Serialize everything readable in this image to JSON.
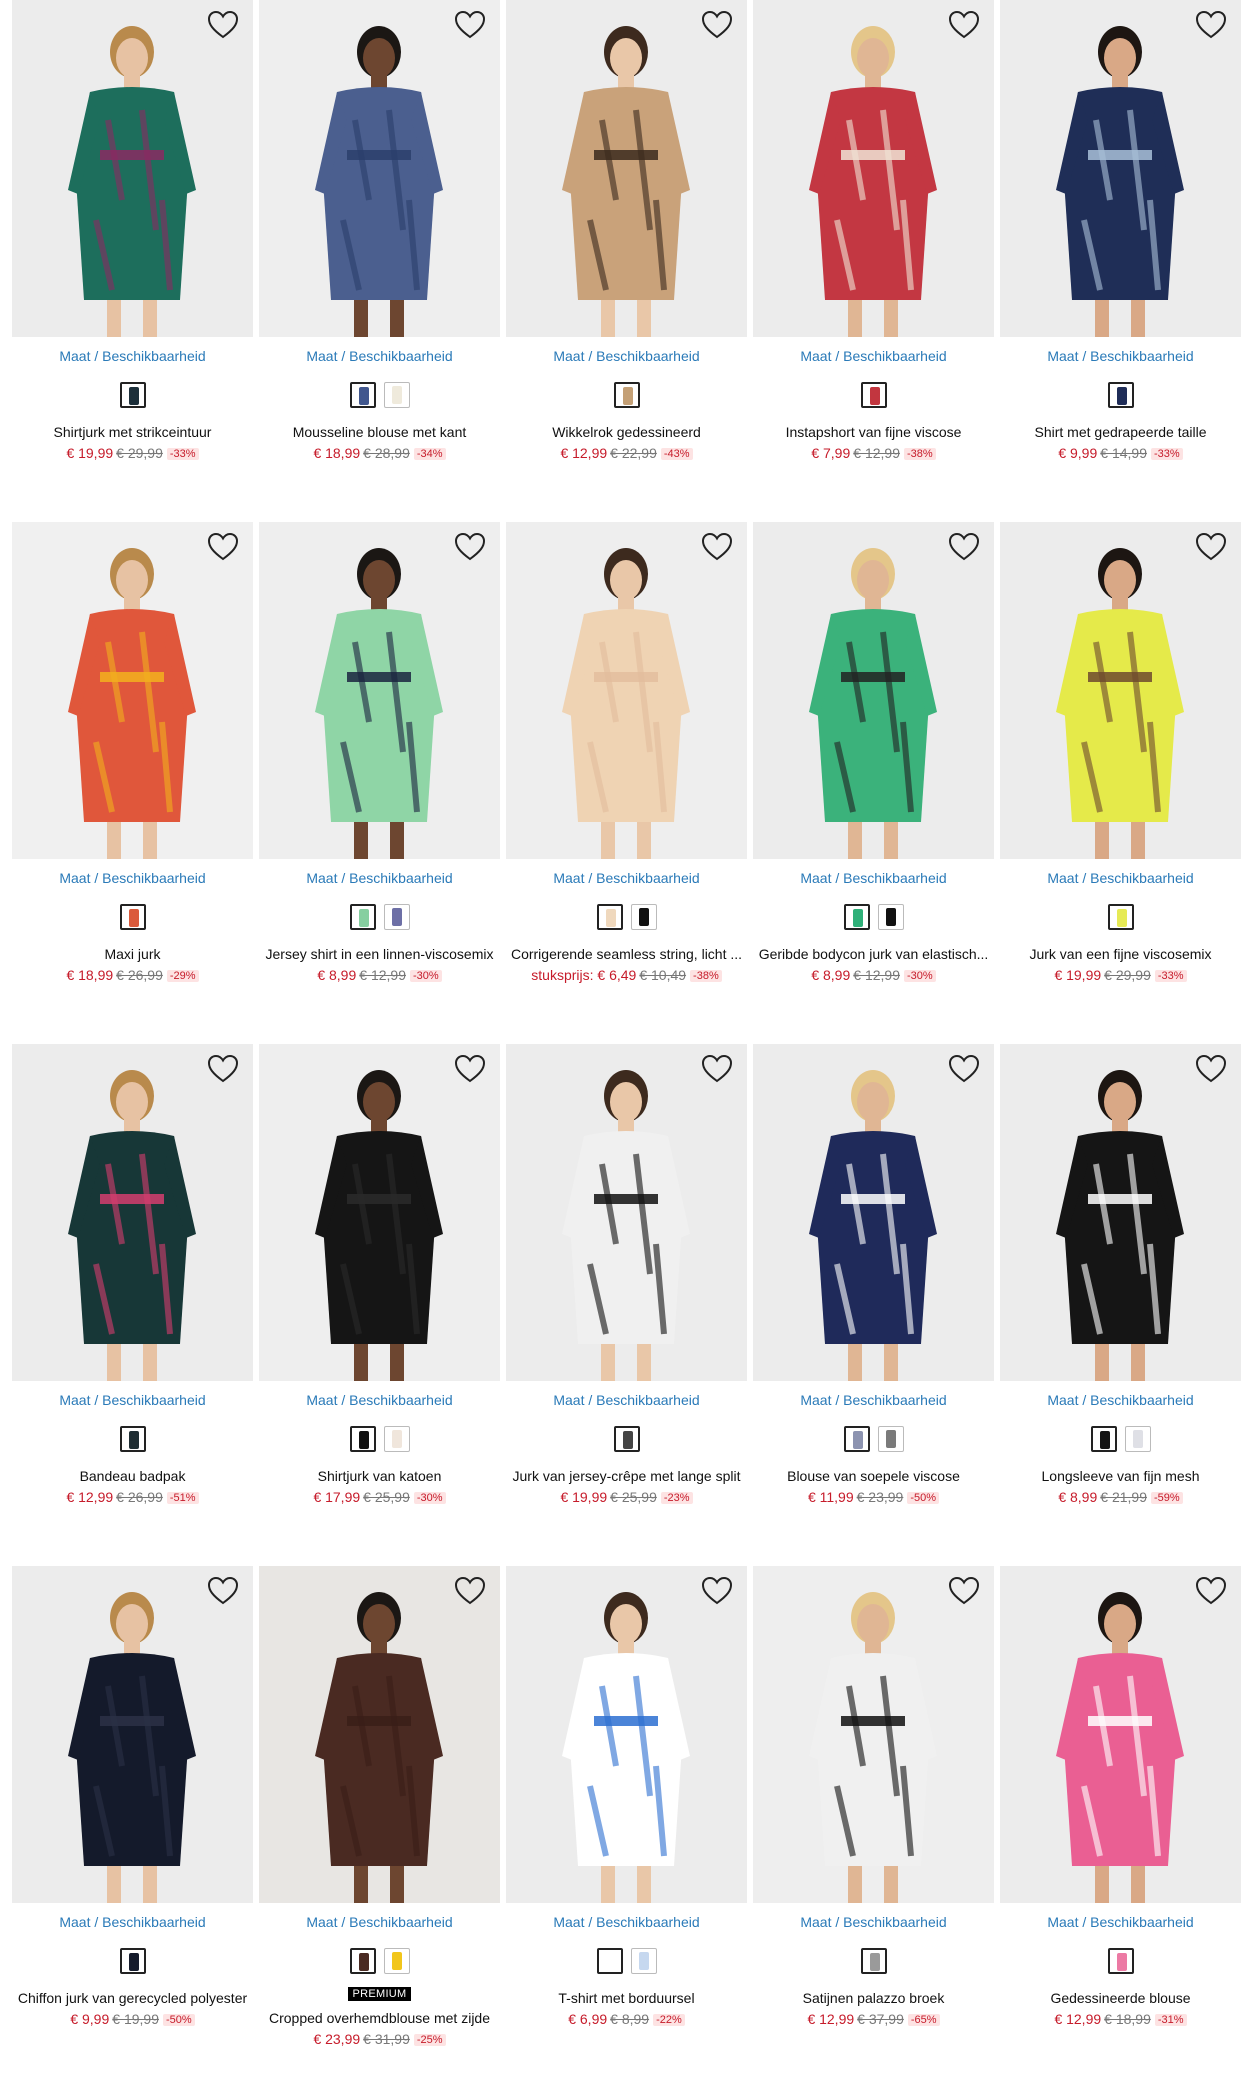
{
  "size_label": "Maat / Beschikbaarheid",
  "premium_label": "PREMIUM",
  "unit_label": "stuksprijs:",
  "products": [
    {
      "name": "Shirtjurk met strikceintuur",
      "price": "€ 19,99",
      "was": "€ 29,99",
      "disc": "-33%",
      "bg": "#ececec",
      "cloth": "#1d6e5c",
      "accent": "#8a2a62",
      "swatches": [
        "#1c2f3a"
      ]
    },
    {
      "name": "Mousseline blouse met kant",
      "price": "€ 18,99",
      "was": "€ 28,99",
      "disc": "-34%",
      "bg": "#eeeeee",
      "cloth": "#4b5f8f",
      "accent": "#2b3f6c",
      "swatches": [
        "#41578e",
        "#efeadc"
      ]
    },
    {
      "name": "Wikkelrok gedessineerd",
      "price": "€ 12,99",
      "was": "€ 22,99",
      "disc": "-43%",
      "bg": "#ececec",
      "cloth": "#c9a27a",
      "accent": "#3b2a1d",
      "swatches": [
        "#c4a076"
      ]
    },
    {
      "name": "Instapshort van fijne viscose",
      "price": "€ 7,99",
      "was": "€ 12,99",
      "disc": "-38%",
      "bg": "#ececec",
      "cloth": "#c33742",
      "accent": "#f0e4d5",
      "swatches": [
        "#c2363f"
      ]
    },
    {
      "name": "Shirt met gedrapeerde taille",
      "price": "€ 9,99",
      "was": "€ 14,99",
      "disc": "-33%",
      "bg": "#ececec",
      "cloth": "#1f2e57",
      "accent": "#a9c0d8",
      "swatches": [
        "#1f2d58"
      ]
    },
    {
      "name": "Maxi jurk",
      "price": "€ 18,99",
      "was": "€ 26,99",
      "disc": "-29%",
      "bg": "#f0f0f0",
      "cloth": "#e0573b",
      "accent": "#f2b01e",
      "swatches": [
        "#db5a3b"
      ]
    },
    {
      "name": "Jersey shirt in een linnen-viscosemix",
      "price": "€ 8,99",
      "was": "€ 12,99",
      "disc": "-30%",
      "bg": "#eeeeee",
      "cloth": "#8fd5a6",
      "accent": "#1b2440",
      "swatches": [
        "#86cfa0",
        "#6d6fa6"
      ]
    },
    {
      "name": "Corrigerende seamless string, licht ...",
      "price": "€ 6,49",
      "was": "€ 10,49",
      "disc": "-38%",
      "bg": "#eeeeee",
      "cloth": "#efd3b3",
      "accent": "#e3bd9d",
      "swatches": [
        "#efd8bd",
        "#111111"
      ],
      "unit": true
    },
    {
      "name": "Geribde bodycon jurk van elastisch...",
      "price": "€ 8,99",
      "was": "€ 12,99",
      "disc": "-30%",
      "bg": "#ececec",
      "cloth": "#3bb27b",
      "accent": "#222222",
      "swatches": [
        "#2fb079",
        "#111111"
      ]
    },
    {
      "name": "Jurk van een fijne viscosemix",
      "price": "€ 19,99",
      "was": "€ 29,99",
      "disc": "-33%",
      "bg": "#ececec",
      "cloth": "#e5ea4a",
      "accent": "#6e4a2e",
      "swatches": [
        "#e6ea55"
      ]
    },
    {
      "name": "Bandeau badpak",
      "price": "€ 12,99",
      "was": "€ 26,99",
      "disc": "-51%",
      "bg": "#ececec",
      "cloth": "#173737",
      "accent": "#d53d6f",
      "swatches": [
        "#1e2d33"
      ]
    },
    {
      "name": "Shirtjurk van katoen",
      "price": "€ 17,99",
      "was": "€ 25,99",
      "disc": "-30%",
      "bg": "#eeeeee",
      "cloth": "#151515",
      "accent": "#2a2a2a",
      "swatches": [
        "#111111",
        "#f0e6dc"
      ]
    },
    {
      "name": "Jurk van jersey-crêpe met lange split",
      "price": "€ 19,99",
      "was": "€ 25,99",
      "disc": "-23%",
      "bg": "#ececec",
      "cloth": "#f0f0f0",
      "accent": "#111111",
      "swatches": [
        "#444444"
      ]
    },
    {
      "name": "Blouse van soepele viscose",
      "price": "€ 11,99",
      "was": "€ 23,99",
      "disc": "-50%",
      "bg": "#ececec",
      "cloth": "#1f2a5a",
      "accent": "#ffffff",
      "swatches": [
        "#8c93b0",
        "#7a7a7a"
      ]
    },
    {
      "name": "Longsleeve van fijn mesh",
      "price": "€ 8,99",
      "was": "€ 21,99",
      "disc": "-59%",
      "bg": "#ececec",
      "cloth": "#151515",
      "accent": "#ffffff",
      "swatches": [
        "#151515",
        "#dfe0e6"
      ]
    },
    {
      "name": "Chiffon jurk van gerecycled polyester",
      "price": "€ 9,99",
      "was": "€ 19,99",
      "disc": "-50%",
      "bg": "#ececec",
      "cloth": "#141a2b",
      "accent": "#2b3146",
      "swatches": [
        "#151b2c"
      ]
    },
    {
      "name": "Cropped overhemdblouse met zijde",
      "price": "€ 23,99",
      "was": "€ 31,99",
      "disc": "-25%",
      "bg": "#e8e6e3",
      "cloth": "#4a2a22",
      "accent": "#3a1e18",
      "swatches": [
        "#4a2a22",
        "#f2c61b"
      ],
      "premium": true
    },
    {
      "name": "T-shirt met borduursel",
      "price": "€ 6,99",
      "was": "€ 8,99",
      "disc": "-22%",
      "bg": "#ececec",
      "cloth": "#ffffff",
      "accent": "#2c6fd1",
      "swatches": [
        "#ffffff",
        "#c6d8ef"
      ]
    },
    {
      "name": "Satijnen palazzo broek",
      "price": "€ 12,99",
      "was": "€ 37,99",
      "disc": "-65%",
      "bg": "#eeeeee",
      "cloth": "#f0f0f0",
      "accent": "#111111",
      "swatches": [
        "#9a9a9a"
      ]
    },
    {
      "name": "Gedessineerde blouse",
      "price": "€ 12,99",
      "was": "€ 18,99",
      "disc": "-31%",
      "bg": "#ececec",
      "cloth": "#ea5f93",
      "accent": "#ffffff",
      "swatches": [
        "#ec7aa4"
      ]
    }
  ]
}
